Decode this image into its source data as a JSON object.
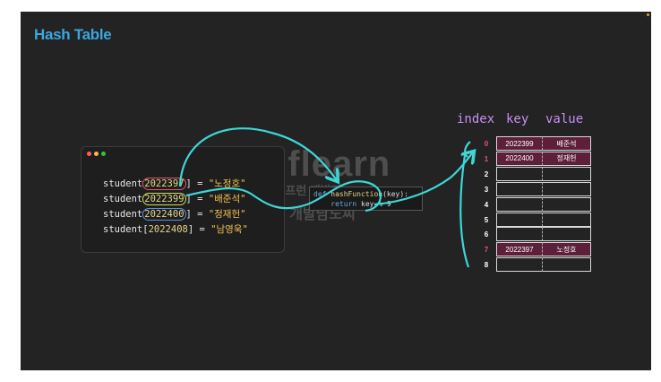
{
  "title": "Hash Table",
  "code_lines": [
    {
      "prefix": "student[",
      "key": "2022397",
      "suffix": "] = ",
      "value": "\"노정호\"",
      "highlight": "#e2546d"
    },
    {
      "prefix": "student[",
      "key": "2022399",
      "suffix": "] = ",
      "value": "\"배준석\"",
      "highlight": "#c7e05b"
    },
    {
      "prefix": "student[",
      "key": "2022400",
      "suffix": "] = ",
      "value": "\"정재헌\"",
      "highlight": "#5b8fe0"
    },
    {
      "prefix": "student[",
      "key": "2022408",
      "suffix": "] = ",
      "value": "\"남영욱\"",
      "highlight": ""
    }
  ],
  "function_code": {
    "line1": {
      "kw": "def",
      "name": "hashFunction",
      "args": "(key):"
    },
    "line2": {
      "kw": "return",
      "expr": "key % 9"
    }
  },
  "table": {
    "headers": {
      "index": "index",
      "key": "key",
      "value": "value"
    },
    "rows": [
      {
        "index": "0",
        "key": "2022399",
        "value": "배준석",
        "filled": true
      },
      {
        "index": "1",
        "key": "2022400",
        "value": "정재헌",
        "filled": true
      },
      {
        "index": "2",
        "key": "",
        "value": "",
        "filled": false
      },
      {
        "index": "3",
        "key": "",
        "value": "",
        "filled": false
      },
      {
        "index": "4",
        "key": "",
        "value": "",
        "filled": false
      },
      {
        "index": "5",
        "key": "",
        "value": "",
        "filled": false
      },
      {
        "index": "6",
        "key": "",
        "value": "",
        "filled": false
      },
      {
        "index": "7",
        "key": "2022397",
        "value": "노정호",
        "filled": true
      },
      {
        "index": "8",
        "key": "",
        "value": "",
        "filled": false
      }
    ]
  },
  "watermark": {
    "logo": "inflearn",
    "line1": "[인프런 개발자 ONE]",
    "line2": "개발남노씨"
  },
  "colors": {
    "accent": "#3aa7df",
    "arrow": "#3ed6d6",
    "header": "#c98df5",
    "filled_cell": "#5e1f3a",
    "hot_index": "#e2546d"
  }
}
